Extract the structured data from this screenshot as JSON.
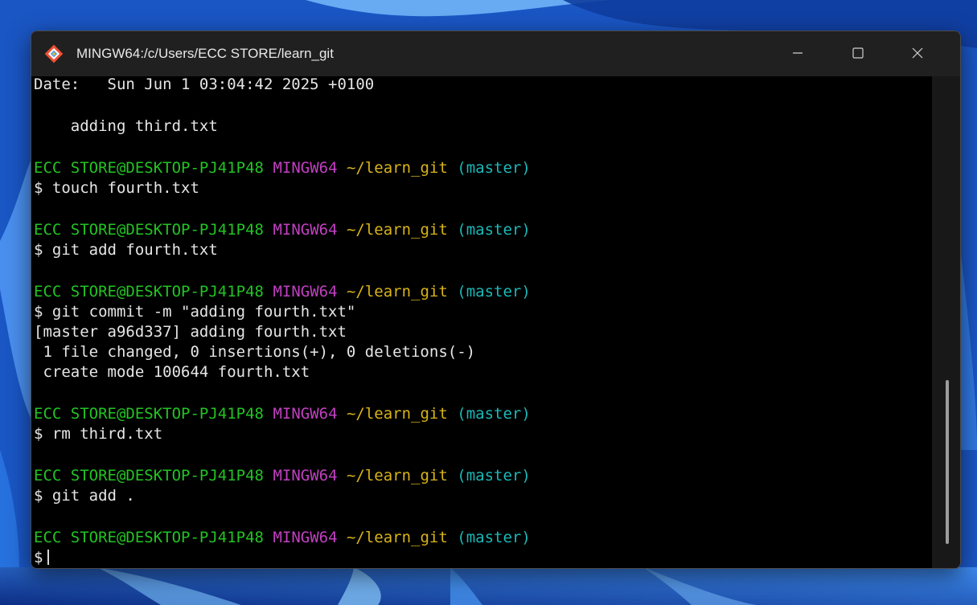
{
  "window": {
    "title": "MINGW64:/c/Users/ECC STORE/learn_git",
    "app_icon": "git-bash-icon",
    "controls": {
      "minimize_icon": "minimize-icon",
      "maximize_icon": "maximize-icon",
      "close_icon": "close-icon"
    }
  },
  "colors": {
    "user_host": "#22c422",
    "msystem": "#c13fc1",
    "path": "#d9b41a",
    "branch": "#1bb8b8",
    "text": "#e6e6e6",
    "background": "#000000",
    "titlebar": "#202020"
  },
  "terminal": {
    "date_line": "Date:   Sun Jun 1 03:04:42 2025 +0100",
    "commit_message": "    adding third.txt",
    "prompt": {
      "user_host": "ECC STORE@DESKTOP-PJ41P48",
      "msystem": "MINGW64",
      "path": "~/learn_git",
      "branch": "(master)"
    },
    "commands": {
      "cmd1": "$ touch fourth.txt",
      "cmd2": "$ git add fourth.txt",
      "cmd3": "$ git commit -m \"adding fourth.txt\"",
      "cmd4": "$ rm third.txt",
      "cmd5": "$ git add .",
      "cmd6": "$"
    },
    "output": {
      "commit_result": "[master a96d337] adding fourth.txt",
      "files_changed": " 1 file changed, 0 insertions(+), 0 deletions(-)",
      "create_mode": " create mode 100644 fourth.txt"
    }
  }
}
